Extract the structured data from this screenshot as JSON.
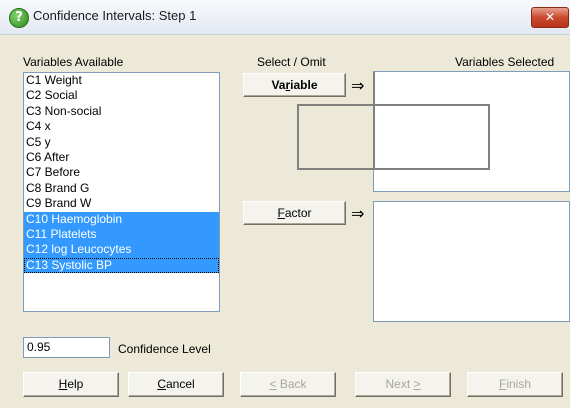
{
  "window": {
    "title": "Confidence Intervals: Step 1",
    "close_label": "✕"
  },
  "labels": {
    "variables_available": "Variables Available",
    "select_omit": "Select / Omit",
    "variables_selected": "Variables Selected",
    "confidence_level": "Confidence Level"
  },
  "variables": [
    {
      "label": "C1 Weight",
      "selected": false
    },
    {
      "label": "C2 Social",
      "selected": false
    },
    {
      "label": "C3 Non-social",
      "selected": false
    },
    {
      "label": "C4 x",
      "selected": false
    },
    {
      "label": "C5 y",
      "selected": false
    },
    {
      "label": "C6 After",
      "selected": false
    },
    {
      "label": "C7 Before",
      "selected": false
    },
    {
      "label": "C8 Brand G",
      "selected": false
    },
    {
      "label": "C9 Brand W",
      "selected": false
    },
    {
      "label": "C10 Haemoglobin",
      "selected": true
    },
    {
      "label": "C11 Platelets",
      "selected": true
    },
    {
      "label": "C12 log Leucocytes",
      "selected": true
    },
    {
      "label": "C13 Systolic BP",
      "selected": true
    }
  ],
  "buttons": {
    "variable": {
      "pre": "Va",
      "u": "r",
      "post": "iable"
    },
    "factor": {
      "pre": "",
      "u": "F",
      "post": "actor"
    },
    "help": {
      "pre": "",
      "u": "H",
      "post": "elp"
    },
    "cancel": {
      "pre": "",
      "u": "C",
      "post": "ancel"
    },
    "back": {
      "pre": "",
      "u": "<",
      "post": " Back"
    },
    "next": {
      "pre": "Next ",
      "u": ">",
      "post": ""
    },
    "finish": {
      "pre": "",
      "u": "F",
      "post": "inish"
    }
  },
  "arrow_glyph": "⇒",
  "confidence_input": {
    "value": "0.95"
  }
}
